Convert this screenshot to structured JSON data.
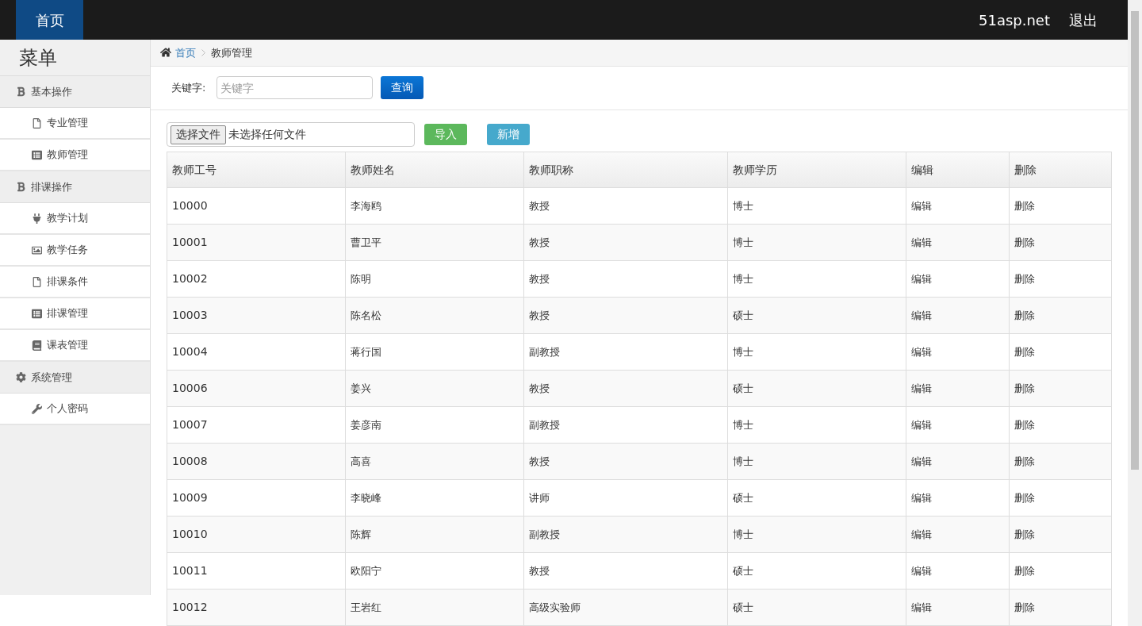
{
  "navbar": {
    "home": "首页",
    "brand": "51asp.net",
    "logout": "退出"
  },
  "sidebar": {
    "title": "菜单",
    "groups": [
      {
        "label": "基本操作",
        "items": [
          {
            "label": "专业管理"
          },
          {
            "label": "教师管理"
          }
        ]
      },
      {
        "label": "排课操作",
        "items": [
          {
            "label": "教学计划"
          },
          {
            "label": "教学任务"
          },
          {
            "label": "排课条件"
          },
          {
            "label": "排课管理"
          },
          {
            "label": "课表管理"
          }
        ]
      },
      {
        "label": "系统管理",
        "items": [
          {
            "label": "个人密码"
          }
        ]
      }
    ]
  },
  "breadcrumb": [
    "首页",
    "教师管理"
  ],
  "search": {
    "label": "关键字:",
    "placeholder": "关键字",
    "button": "查询"
  },
  "upload": {
    "choose": "选择文件",
    "status": "未选择任何文件",
    "import": "导入",
    "add": "新增"
  },
  "table": {
    "columns": [
      "教师工号",
      "教师姓名",
      "教师职称",
      "教师学历",
      "编辑",
      "删除"
    ],
    "rows": [
      [
        "10000",
        "李海鸥",
        "教授",
        "博士",
        "编辑",
        "删除"
      ],
      [
        "10001",
        "曹卫平",
        "教授",
        "博士",
        "编辑",
        "删除"
      ],
      [
        "10002",
        "陈明",
        "教授",
        "博士",
        "编辑",
        "删除"
      ],
      [
        "10003",
        "陈名松",
        "教授",
        "硕士",
        "编辑",
        "删除"
      ],
      [
        "10004",
        "蒋行国",
        "副教授",
        "博士",
        "编辑",
        "删除"
      ],
      [
        "10006",
        "姜兴",
        "教授",
        "硕士",
        "编辑",
        "删除"
      ],
      [
        "10007",
        "姜彦南",
        "副教授",
        "博士",
        "编辑",
        "删除"
      ],
      [
        "10008",
        "高喜",
        "教授",
        "博士",
        "编辑",
        "删除"
      ],
      [
        "10009",
        "李晓峰",
        "讲师",
        "硕士",
        "编辑",
        "删除"
      ],
      [
        "10010",
        "陈辉",
        "副教授",
        "博士",
        "编辑",
        "删除"
      ],
      [
        "10011",
        "欧阳宁",
        "教授",
        "硕士",
        "编辑",
        "删除"
      ],
      [
        "10012",
        "王岩红",
        "高级实验师",
        "硕士",
        "编辑",
        "删除"
      ]
    ]
  }
}
